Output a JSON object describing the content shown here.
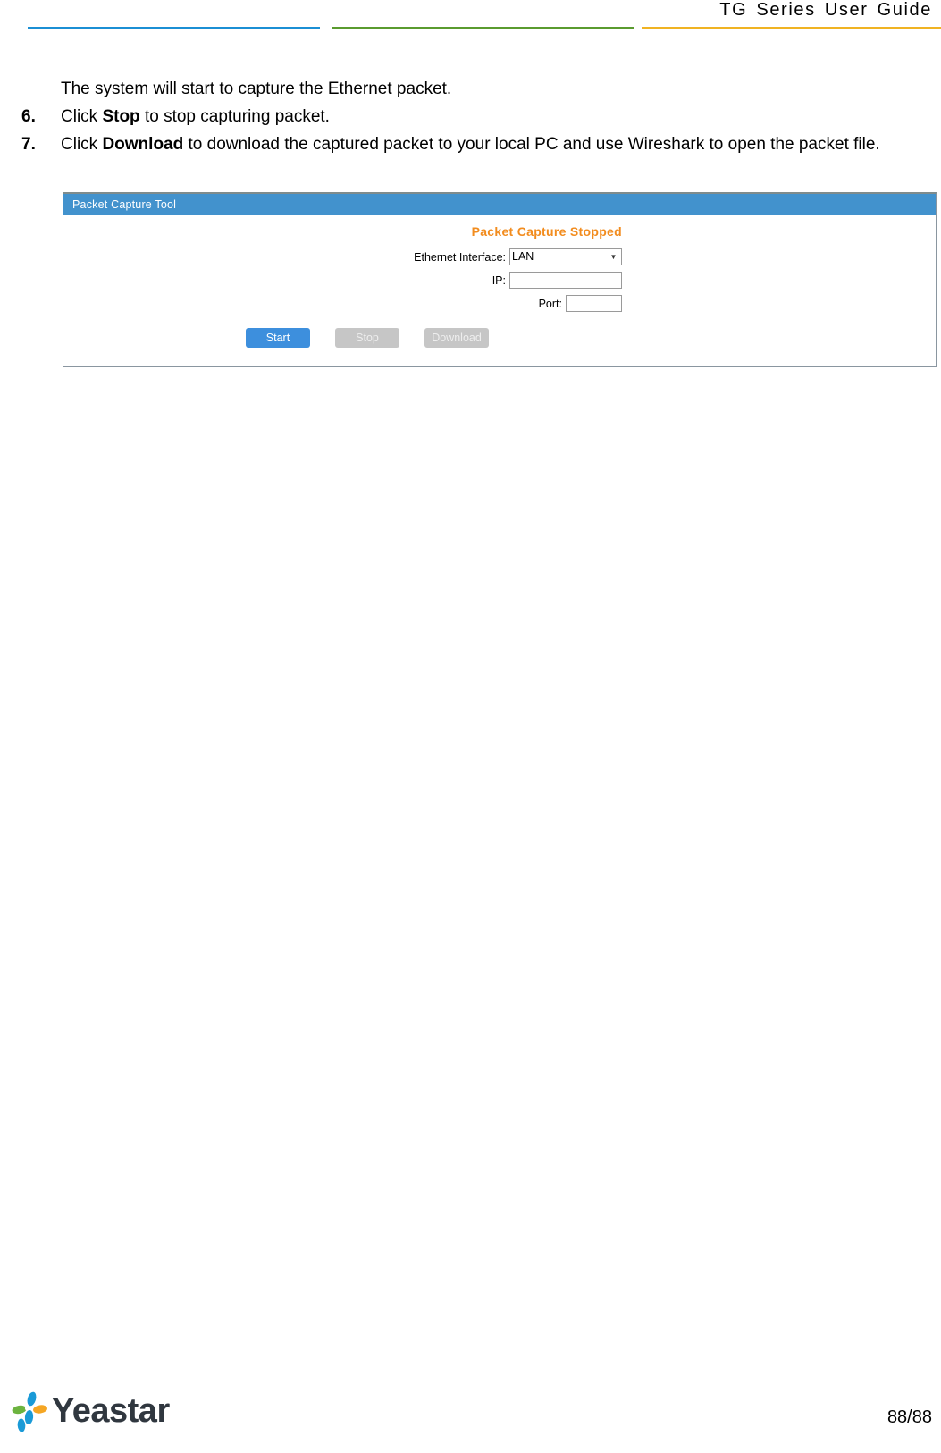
{
  "header": {
    "title": "TG  Series  User  Guide",
    "rules": [
      {
        "name": "blue-rule",
        "color": "#1b8fd4"
      },
      {
        "name": "green-rule",
        "color": "#5a9b2f"
      },
      {
        "name": "yellow-rule",
        "color": "#f0b323"
      }
    ]
  },
  "body": {
    "intro": "The system will start to capture the Ethernet packet.",
    "steps": [
      {
        "number": "6.",
        "prefix": "Click ",
        "bold": "Stop",
        "suffix": " to stop capturing packet."
      },
      {
        "number": "7.",
        "prefix": "Click ",
        "bold": "Download",
        "suffix": " to download the captured packet to  your local PC and use Wireshark to open the packet file."
      }
    ]
  },
  "packet_capture_tool": {
    "panel_title": "Packet Capture Tool",
    "status_text": "Packet Capture Stopped",
    "status_color": "#f28c1e",
    "titlebar_color": "#4292cd",
    "fields": {
      "interface_label": "Ethernet Interface:",
      "interface_value": "LAN",
      "interface_options": [
        "LAN"
      ],
      "ip_label": "IP:",
      "ip_value": "",
      "port_label": "Port:",
      "port_value": ""
    },
    "buttons": {
      "start": "Start",
      "stop": "Stop",
      "download": "Download",
      "start_color": "#3d8fdd",
      "disabled_color": "#c6c6c6"
    }
  },
  "footer": {
    "logo_text": "Yeastar",
    "page_number": "88/88"
  }
}
